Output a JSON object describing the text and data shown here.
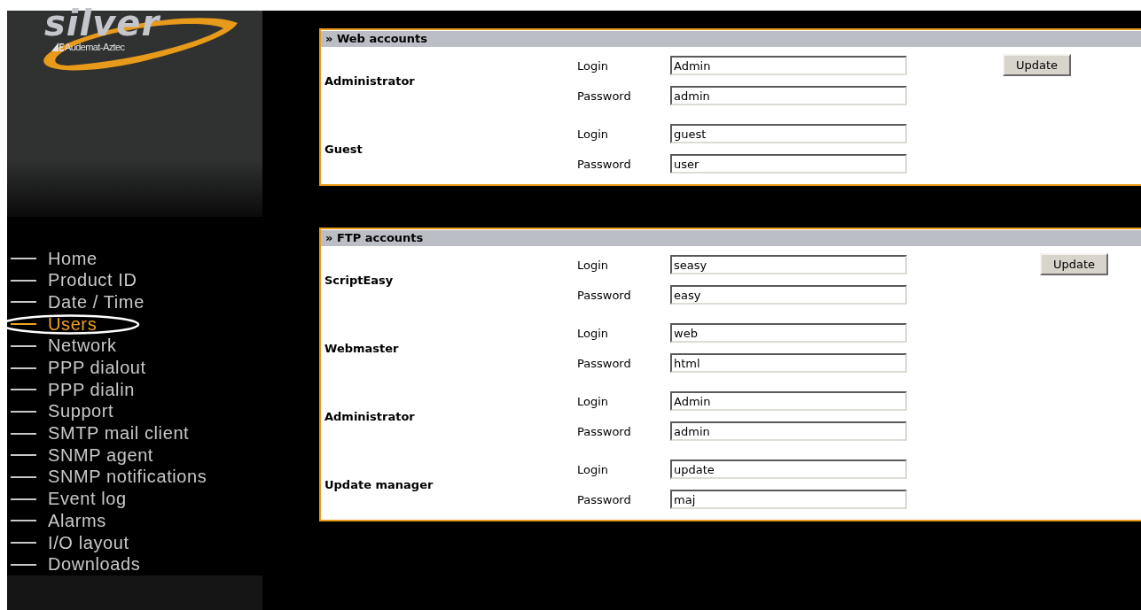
{
  "logo": {
    "wordmark": "silver",
    "maker": "Audemat-Aztec"
  },
  "menu": [
    {
      "label": "Home",
      "selected": false
    },
    {
      "label": "Product ID",
      "selected": false
    },
    {
      "label": "Date / Time",
      "selected": false
    },
    {
      "label": "Users",
      "selected": true
    },
    {
      "label": "Network",
      "selected": false
    },
    {
      "label": "PPP dialout",
      "selected": false
    },
    {
      "label": "PPP dialin",
      "selected": false
    },
    {
      "label": "Support",
      "selected": false
    },
    {
      "label": "SMTP mail client",
      "selected": false
    },
    {
      "label": "SNMP agent",
      "selected": false
    },
    {
      "label": "SNMP notifications",
      "selected": false
    },
    {
      "label": "Event log",
      "selected": false
    },
    {
      "label": "Alarms",
      "selected": false
    },
    {
      "label": "I/O layout",
      "selected": false
    },
    {
      "label": "Downloads",
      "selected": false
    }
  ],
  "panels": [
    {
      "title": "» Web accounts",
      "button": "Update",
      "accounts": [
        {
          "name": "Administrator",
          "fields": [
            {
              "label": "Login",
              "value": "Admin"
            },
            {
              "label": "Password",
              "value": "admin"
            }
          ]
        },
        {
          "name": "Guest",
          "fields": [
            {
              "label": "Login",
              "value": "guest"
            },
            {
              "label": "Password",
              "value": "user"
            }
          ]
        }
      ]
    },
    {
      "title": "» FTP accounts",
      "button": "Update",
      "accounts": [
        {
          "name": "ScriptEasy",
          "fields": [
            {
              "label": "Login",
              "value": "seasy"
            },
            {
              "label": "Password",
              "value": "easy"
            }
          ]
        },
        {
          "name": "Webmaster",
          "fields": [
            {
              "label": "Login",
              "value": "web"
            },
            {
              "label": "Password",
              "value": "html"
            }
          ]
        },
        {
          "name": "Administrator",
          "fields": [
            {
              "label": "Login",
              "value": "Admin"
            },
            {
              "label": "Password",
              "value": "admin"
            }
          ]
        },
        {
          "name": "Update manager",
          "fields": [
            {
              "label": "Login",
              "value": "update"
            },
            {
              "label": "Password",
              "value": "maj"
            }
          ]
        }
      ]
    }
  ]
}
